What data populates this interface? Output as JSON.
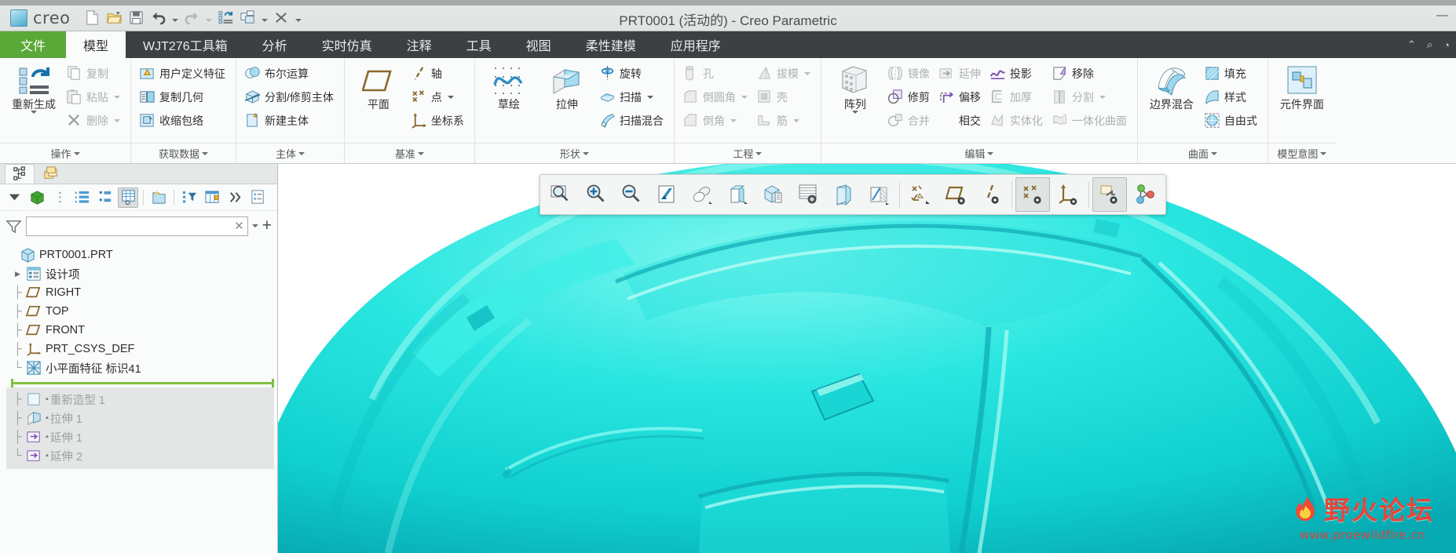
{
  "window": {
    "title": "PRT0001 (活动的) - Creo Parametric",
    "brand": "creo",
    "minimize_label": "—",
    "maximize_label": "❐",
    "close_label": "✕"
  },
  "quick_access": [
    {
      "name": "new-file",
      "label": "新建",
      "icon": "new-file-icon"
    },
    {
      "name": "open-file",
      "label": "打开",
      "icon": "open-folder-icon"
    },
    {
      "name": "save-file",
      "label": "保存",
      "icon": "save-icon"
    },
    {
      "name": "undo",
      "label": "撤消",
      "icon": "undo-icon",
      "caret": true
    },
    {
      "name": "redo",
      "label": "重做",
      "icon": "redo-icon",
      "caret": true,
      "disabled": true
    },
    {
      "name": "regenerate",
      "label": "重新生成",
      "icon": "regenerate-icon"
    },
    {
      "name": "window",
      "label": "窗口",
      "icon": "windows-icon",
      "caret": true
    },
    {
      "name": "close-window",
      "label": "关闭",
      "icon": "close-window-icon"
    },
    {
      "name": "customize-qat",
      "label": "自定义快速访问工具栏",
      "icon": "chevron-down-icon"
    }
  ],
  "tabs": [
    {
      "label": "文件",
      "kind": "file"
    },
    {
      "label": "模型",
      "kind": "active"
    },
    {
      "label": "WJT276工具箱",
      "kind": "normal"
    },
    {
      "label": "分析",
      "kind": "normal"
    },
    {
      "label": "实时仿真",
      "kind": "normal"
    },
    {
      "label": "注释",
      "kind": "normal"
    },
    {
      "label": "工具",
      "kind": "normal"
    },
    {
      "label": "视图",
      "kind": "normal"
    },
    {
      "label": "柔性建模",
      "kind": "normal"
    },
    {
      "label": "应用程序",
      "kind": "normal"
    }
  ],
  "ribbon_right": [
    "▲",
    "⌕",
    "◔"
  ],
  "ribbon": {
    "groups": [
      {
        "label": "操作",
        "big": [
          {
            "label": "重新生成",
            "icon": "regenerate-big-icon",
            "caret": true
          }
        ],
        "columns": [
          [
            {
              "label": "复制",
              "icon": "copy-icon",
              "dim": true
            },
            {
              "label": "粘贴",
              "icon": "paste-icon",
              "dim": true,
              "caret": true
            },
            {
              "label": "删除",
              "icon": "delete-x-icon",
              "dim": true,
              "caret": true
            }
          ]
        ]
      },
      {
        "label": "获取数据",
        "columns": [
          [
            {
              "label": "用户定义特征",
              "icon": "udf-icon"
            },
            {
              "label": "复制几何",
              "icon": "copy-geometry-icon"
            },
            {
              "label": "收缩包络",
              "icon": "shrinkwrap-icon"
            }
          ]
        ]
      },
      {
        "label": "主体",
        "columns": [
          [
            {
              "label": "布尔运算",
              "icon": "boolean-icon"
            },
            {
              "label": "分割/修剪主体",
              "icon": "split-body-icon"
            },
            {
              "label": "新建主体",
              "icon": "new-body-icon"
            }
          ]
        ]
      },
      {
        "label": "基准",
        "big": [
          {
            "label": "平面",
            "icon": "datum-plane-icon"
          }
        ],
        "columns": [
          [
            {
              "label": "轴",
              "icon": "datum-axis-icon"
            },
            {
              "label": "点",
              "icon": "datum-point-icon",
              "caret": true
            },
            {
              "label": "坐标系",
              "icon": "datum-csys-icon"
            }
          ]
        ]
      },
      {
        "label": "形状",
        "big": [
          {
            "label": "草绘",
            "icon": "sketch-icon"
          },
          {
            "label": "拉伸",
            "icon": "extrude-icon"
          }
        ],
        "columns": [
          [
            {
              "label": "旋转",
              "icon": "revolve-icon"
            },
            {
              "label": "扫描",
              "icon": "sweep-icon",
              "caret": true
            },
            {
              "label": "扫描混合",
              "icon": "swept-blend-icon"
            }
          ]
        ]
      },
      {
        "label": "工程",
        "columns": [
          [
            {
              "label": "孔",
              "icon": "hole-icon",
              "dim": true
            },
            {
              "label": "倒圆角",
              "icon": "round-icon",
              "dim": true,
              "caret": true
            },
            {
              "label": "倒角",
              "icon": "chamfer-icon",
              "dim": true,
              "caret": true
            }
          ],
          [
            {
              "label": "拔模",
              "icon": "draft-icon",
              "dim": true,
              "caret": true
            },
            {
              "label": "壳",
              "icon": "shell-icon",
              "dim": true
            },
            {
              "label": "筋",
              "icon": "rib-icon",
              "dim": true,
              "caret": true
            }
          ]
        ]
      },
      {
        "label": "编辑",
        "big": [
          {
            "label": "阵列",
            "icon": "pattern-icon",
            "caret": true
          }
        ],
        "columns": [
          [
            {
              "label": "镜像",
              "icon": "mirror-icon",
              "dim": true
            },
            {
              "label": "修剪",
              "icon": "trim-icon"
            },
            {
              "label": "合并",
              "icon": "merge-icon",
              "dim": true
            }
          ],
          [
            {
              "label": "延伸",
              "icon": "extend-icon",
              "dim": true
            },
            {
              "label": "偏移",
              "icon": "offset-icon"
            },
            {
              "label": "相交",
              "icon": "intersect-icon"
            }
          ],
          [
            {
              "label": "投影",
              "icon": "project-icon"
            },
            {
              "label": "加厚",
              "icon": "thicken-icon",
              "dim": true
            },
            {
              "label": "实体化",
              "icon": "solidify-icon",
              "dim": true
            }
          ],
          [
            {
              "label": "移除",
              "icon": "remove-surface-icon"
            },
            {
              "label": "分割",
              "icon": "split-surface-icon",
              "dim": true,
              "caret": true
            },
            {
              "label": "一体化曲面",
              "icon": "wrap-surface-icon",
              "dim": true
            }
          ]
        ]
      },
      {
        "label": "曲面",
        "big": [
          {
            "label": "边界混合",
            "icon": "boundary-blend-icon"
          }
        ],
        "columns": [
          [
            {
              "label": "填充",
              "icon": "fill-icon"
            },
            {
              "label": "样式",
              "icon": "style-icon"
            },
            {
              "label": "自由式",
              "icon": "freestyle-icon"
            }
          ]
        ]
      },
      {
        "label": "模型意图",
        "big": [
          {
            "label": "元件界面",
            "icon": "component-interface-icon"
          }
        ],
        "columns": []
      }
    ]
  },
  "left_panel": {
    "nav_tabs": [
      {
        "name": "model-tree-tab",
        "icon": "model-tree-icon",
        "selected": true
      },
      {
        "name": "layer-tree-tab",
        "icon": "layers-icon",
        "selected": false
      }
    ],
    "tree_toolbar": [
      {
        "name": "tree-settings-caret",
        "icon": "chevron-down-icon"
      },
      {
        "name": "show-model-button",
        "icon": "green-cube-icon"
      },
      {
        "name": "drag-handle",
        "icon": "dots-handle-icon"
      },
      {
        "name": "tree-list-button",
        "icon": "tree-list-icon"
      },
      {
        "name": "tree-columns-button",
        "icon": "tree-compact-icon"
      },
      {
        "name": "tree-columns-toggle",
        "icon": "tree-table-icon",
        "active": true
      },
      {
        "name": "folder-browser-button",
        "icon": "folder-star-icon"
      },
      {
        "name": "tree-filter-button",
        "icon": "tree-filter-icon"
      },
      {
        "name": "tree-columns-config-button",
        "icon": "tree-config-icon"
      },
      {
        "name": "more-button",
        "icon": "chevron-double-right-icon"
      },
      {
        "name": "tree-detail-button",
        "icon": "tree-detail-icon"
      }
    ],
    "filter": {
      "icon": "filter-funnel-icon",
      "value": "",
      "placeholder": "",
      "clear_label": "✕",
      "dropdown_label": "▾",
      "add_label": "+"
    },
    "tree": {
      "root": {
        "label": "PRT0001.PRT",
        "icon": "part-icon"
      },
      "items": [
        {
          "label": "设计项",
          "icon": "design-items-icon",
          "expandable": true,
          "lead": "expander"
        },
        {
          "label": "RIGHT",
          "icon": "datum-plane-small-icon",
          "lead": "dash"
        },
        {
          "label": "TOP",
          "icon": "datum-plane-small-icon",
          "lead": "dash"
        },
        {
          "label": "FRONT",
          "icon": "datum-plane-small-icon",
          "lead": "dash"
        },
        {
          "label": "PRT_CSYS_DEF",
          "icon": "csys-small-icon",
          "lead": "dash"
        },
        {
          "label": "小平面特征 标识41",
          "icon": "facet-feature-icon",
          "lead": "dash-end"
        }
      ],
      "inactive_items": [
        {
          "label": "重新造型 1",
          "icon": "restyle-icon",
          "mark": "▪"
        },
        {
          "label": "拉伸 1",
          "icon": "extrude-small-icon",
          "mark": "▪"
        },
        {
          "label": "延伸 1",
          "icon": "extend-small-icon",
          "mark": "▪"
        },
        {
          "label": "延伸 2",
          "icon": "extend-small-icon",
          "mark": "▪"
        }
      ]
    }
  },
  "graphics_toolbar": [
    {
      "name": "refit-button",
      "icon": "zoom-fit-icon"
    },
    {
      "name": "zoom-in-button",
      "icon": "zoom-in-icon"
    },
    {
      "name": "zoom-out-button",
      "icon": "zoom-out-icon"
    },
    {
      "name": "repaint-button",
      "icon": "repaint-icon"
    },
    {
      "name": "display-style-button",
      "icon": "shading-style-icon",
      "caret": true
    },
    {
      "name": "saved-orientations-button",
      "icon": "named-view-icon",
      "caret": true
    },
    {
      "name": "view-manager-button",
      "icon": "view-manager-icon"
    },
    {
      "name": "annotation-display-button",
      "icon": "annotation-display-icon"
    },
    {
      "name": "perspective-view-button",
      "icon": "perspective-view-icon"
    },
    {
      "name": "section-button",
      "icon": "section-icon",
      "caret": true
    },
    {
      "name": "datum-display-button",
      "icon": "datum-display-icon",
      "caret": true
    },
    {
      "name": "plane-display-button",
      "icon": "plane-display-icon"
    },
    {
      "name": "axis-display-button",
      "icon": "axis-display-icon"
    },
    {
      "name": "point-display-button",
      "icon": "point-display-icon",
      "active": true
    },
    {
      "name": "csys-display-button",
      "icon": "csys-display-icon"
    },
    {
      "name": "annotation-toggle-button",
      "icon": "annotation-toggle-icon",
      "active": true
    },
    {
      "name": "spin-center-button",
      "icon": "spin-center-icon"
    }
  ],
  "watermark": {
    "text_cn": "野火论坛",
    "url": "www.proewildfire.cn",
    "color": "#e0443c"
  },
  "model": {
    "surface_color": "#16dedd",
    "background_color": "#ffffff"
  }
}
